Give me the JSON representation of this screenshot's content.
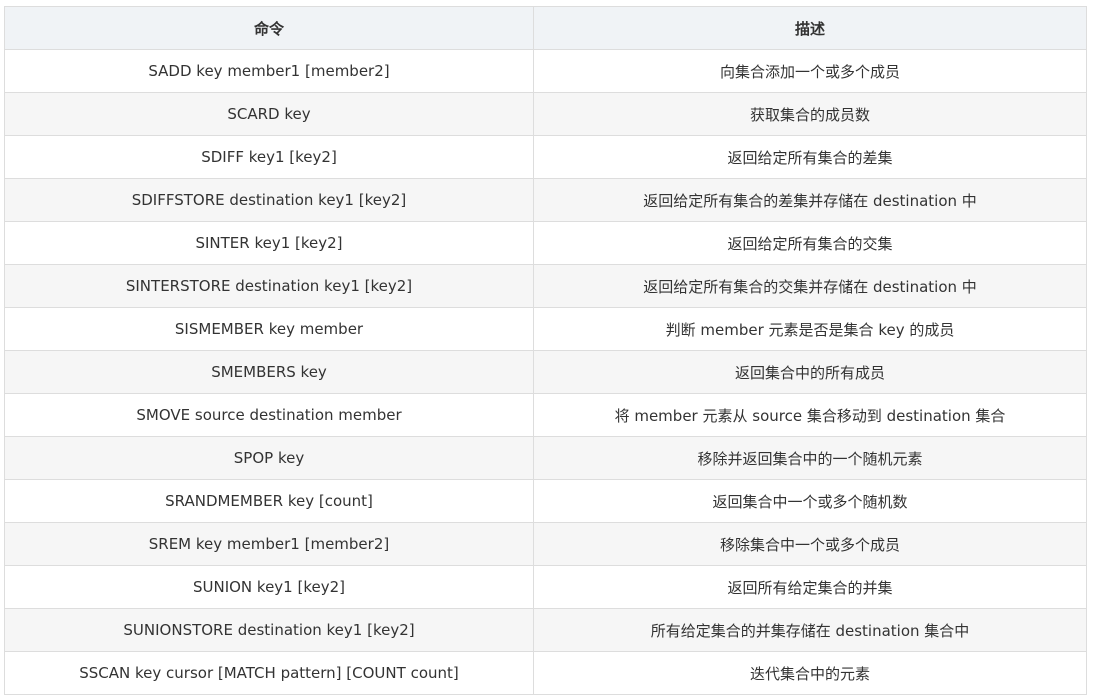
{
  "table": {
    "headers": [
      "命令",
      "描述"
    ],
    "rows": [
      {
        "command": "SADD key member1 [member2]",
        "description": "向集合添加一个或多个成员"
      },
      {
        "command": "SCARD key",
        "description": "获取集合的成员数"
      },
      {
        "command": "SDIFF key1 [key2]",
        "description": "返回给定所有集合的差集"
      },
      {
        "command": "SDIFFSTORE destination key1 [key2]",
        "description": "返回给定所有集合的差集并存储在 destination 中"
      },
      {
        "command": "SINTER key1 [key2]",
        "description": "返回给定所有集合的交集"
      },
      {
        "command": "SINTERSTORE destination key1 [key2]",
        "description": "返回给定所有集合的交集并存储在 destination 中"
      },
      {
        "command": "SISMEMBER key member",
        "description": "判断 member 元素是否是集合 key 的成员"
      },
      {
        "command": "SMEMBERS key",
        "description": "返回集合中的所有成员"
      },
      {
        "command": "SMOVE source destination member",
        "description": "将 member 元素从 source 集合移动到 destination 集合"
      },
      {
        "command": "SPOP key",
        "description": "移除并返回集合中的一个随机元素"
      },
      {
        "command": "SRANDMEMBER key [count]",
        "description": "返回集合中一个或多个随机数"
      },
      {
        "command": "SREM key member1 [member2]",
        "description": "移除集合中一个或多个成员"
      },
      {
        "command": "SUNION key1 [key2]",
        "description": "返回所有给定集合的并集"
      },
      {
        "command": "SUNIONSTORE destination key1 [key2]",
        "description": "所有给定集合的并集存储在 destination 集合中"
      },
      {
        "command": "SSCAN key cursor [MATCH pattern] [COUNT count]",
        "description": "迭代集合中的元素"
      }
    ]
  }
}
